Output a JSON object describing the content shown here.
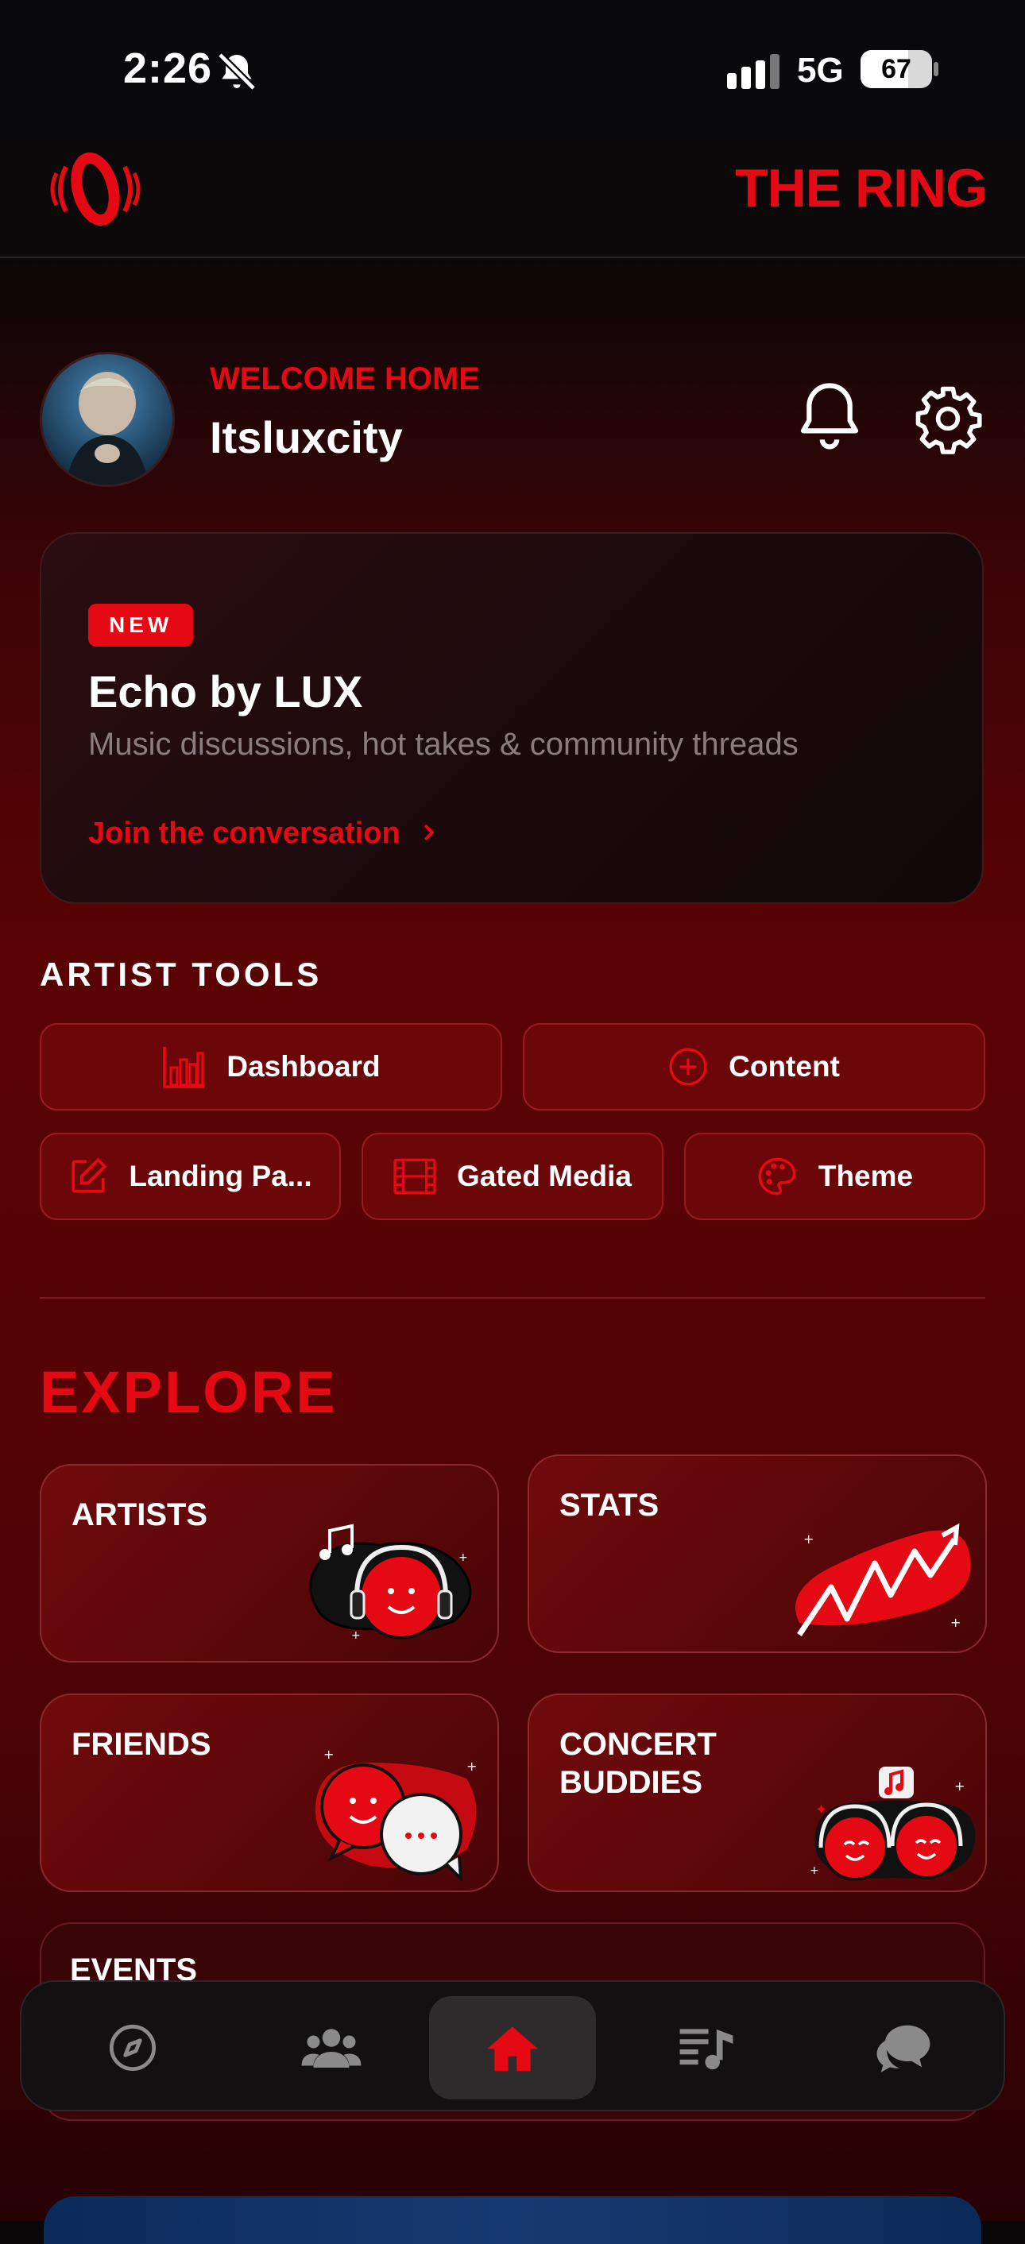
{
  "status": {
    "time": "2:26",
    "network": "5G",
    "battery": "67"
  },
  "header": {
    "brand": "THE RING",
    "logo_icon": "ring-logo-icon"
  },
  "profile": {
    "greeting": "WELCOME HOME",
    "username": "Itsluxcity"
  },
  "promo": {
    "badge": "NEW",
    "title": "Echo by LUX",
    "subtitle": "Music discussions, hot takes & community threads",
    "cta": "Join the conversation"
  },
  "artist_tools": {
    "heading": "ARTIST TOOLS",
    "items": [
      {
        "label": "Dashboard",
        "icon": "bar-chart-icon"
      },
      {
        "label": "Content",
        "icon": "plus-circle-icon"
      },
      {
        "label": "Landing Pa...",
        "icon": "edit-icon"
      },
      {
        "label": "Gated Media",
        "icon": "film-icon"
      },
      {
        "label": "Theme",
        "icon": "palette-icon"
      }
    ]
  },
  "explore": {
    "heading": "EXPLORE",
    "cards": [
      {
        "label": "ARTISTS"
      },
      {
        "label": "STATS"
      },
      {
        "label": "FRIENDS"
      },
      {
        "label": "CONCERT BUDDIES"
      },
      {
        "label": "EVENTS"
      }
    ]
  },
  "nav": {
    "items": [
      "compass-icon",
      "community-icon",
      "home-icon",
      "playlist-icon",
      "chat-icon"
    ],
    "active": "home-icon"
  },
  "colors": {
    "accent": "#e50914",
    "background": "#090708"
  }
}
